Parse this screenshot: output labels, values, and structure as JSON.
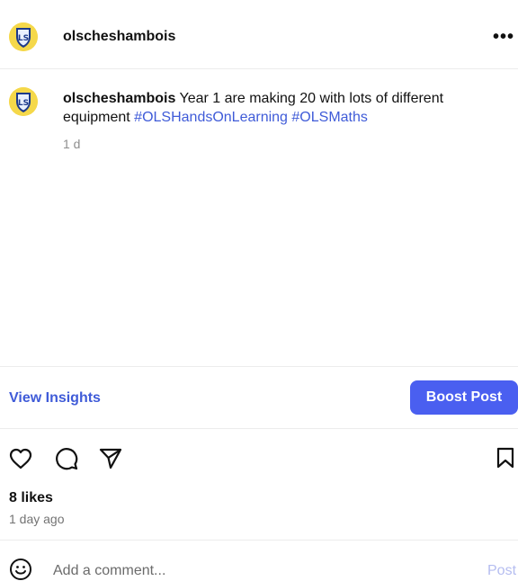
{
  "header": {
    "username": "olscheshambois",
    "more_label": "•••",
    "logo_text": "LS"
  },
  "post": {
    "username": "olscheshambois",
    "caption_text": " Year 1 are making 20 with lots of different equipment ",
    "hashtags": [
      "#OLSHandsOnLearning",
      "#OLSMaths"
    ],
    "time": "1 d"
  },
  "actions": {
    "insights_label": "View Insights",
    "boost_label": "Boost Post"
  },
  "engagement": {
    "likes": "8 likes",
    "posted": "1 day ago"
  },
  "comment": {
    "placeholder": "Add a comment...",
    "post_label": "Post"
  },
  "colors": {
    "link_blue": "#3f5bd8",
    "boost_bg": "#4a5ff0",
    "logo_yellow": "#f5d84a",
    "logo_navy": "#1d3a8a"
  },
  "icons": [
    "more-icon",
    "heart-icon",
    "comment-icon",
    "share-icon",
    "bookmark-icon",
    "emoji-icon"
  ]
}
